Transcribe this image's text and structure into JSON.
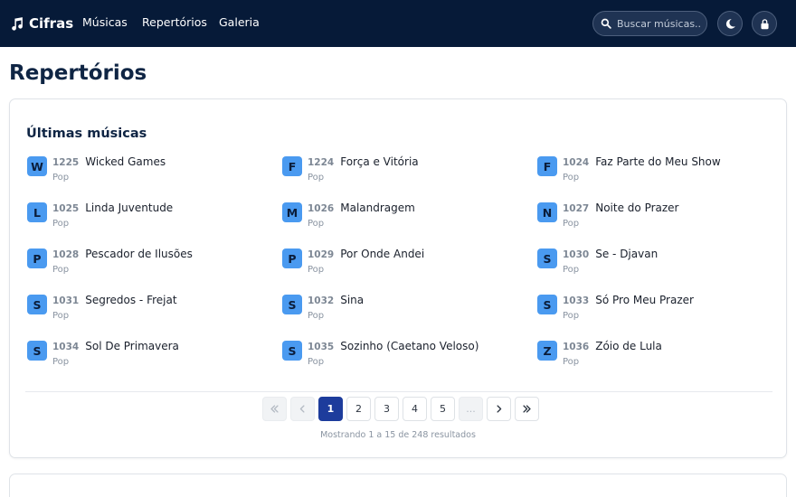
{
  "navbar": {
    "brand": "Cifras",
    "links": [
      "Músicas",
      "Repertórios",
      "Galeria"
    ],
    "search_placeholder": "Buscar músicas..."
  },
  "page": {
    "title": "Repertórios"
  },
  "latest": {
    "title": "Últimas músicas",
    "songs": [
      {
        "letter": "W",
        "number": "1225",
        "title": "Wicked Games",
        "genre": "Pop"
      },
      {
        "letter": "F",
        "number": "1224",
        "title": "Força e Vitória",
        "genre": "Pop"
      },
      {
        "letter": "F",
        "number": "1024",
        "title": "Faz Parte do Meu Show",
        "genre": "Pop"
      },
      {
        "letter": "L",
        "number": "1025",
        "title": "Linda Juventude",
        "genre": "Pop"
      },
      {
        "letter": "M",
        "number": "1026",
        "title": "Malandragem",
        "genre": "Pop"
      },
      {
        "letter": "N",
        "number": "1027",
        "title": "Noite do Prazer",
        "genre": "Pop"
      },
      {
        "letter": "P",
        "number": "1028",
        "title": "Pescador de Ilusões",
        "genre": "Pop"
      },
      {
        "letter": "P",
        "number": "1029",
        "title": "Por Onde Andei",
        "genre": "Pop"
      },
      {
        "letter": "S",
        "number": "1030",
        "title": "Se - Djavan",
        "genre": "Pop"
      },
      {
        "letter": "S",
        "number": "1031",
        "title": "Segredos - Frejat",
        "genre": "Pop"
      },
      {
        "letter": "S",
        "number": "1032",
        "title": "Sina",
        "genre": "Pop"
      },
      {
        "letter": "S",
        "number": "1033",
        "title": "Só Pro Meu Prazer",
        "genre": "Pop"
      },
      {
        "letter": "S",
        "number": "1034",
        "title": "Sol De Primavera",
        "genre": "Pop"
      },
      {
        "letter": "S",
        "number": "1035",
        "title": "Sozinho (Caetano Veloso)",
        "genre": "Pop"
      },
      {
        "letter": "Z",
        "number": "1036",
        "title": "Zóio de Lula",
        "genre": "Pop"
      }
    ]
  },
  "pagination": {
    "pages": [
      "1",
      "2",
      "3",
      "4",
      "5"
    ],
    "current": "1",
    "ellipsis": "...",
    "result_text": "Mostrando 1 a 15 de 248 resultados"
  },
  "colors": {
    "navbar_bg": "#061a38",
    "letter_badge": "#4a9af0",
    "active_page": "#1d3c9c"
  },
  "icons": {
    "brand": "music-note-icon",
    "search": "search-icon",
    "theme": "moon-icon",
    "auth": "lock-icon"
  }
}
